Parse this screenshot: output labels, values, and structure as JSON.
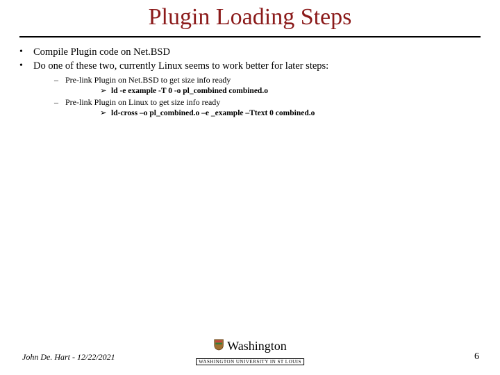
{
  "title": "Plugin Loading Steps",
  "bullets": {
    "b1": "Compile Plugin code on Net.BSD",
    "b2": "Do one of these two, currently Linux seems to work better for later steps:",
    "s1": "Pre-link Plugin on Net.BSD to get size info ready",
    "c1": "ld -e example -T 0 -o pl_combined combined.o",
    "s2": "Pre-link Plugin on Linux to get size info ready",
    "c2": "ld-cross –o pl_combined.o –e _example  –Ttext 0  combined.o"
  },
  "footer": {
    "author": "John De. Hart - 12/22/2021",
    "university": "Washington",
    "subtitle": "WASHINGTON UNIVERSITY IN ST LOUIS",
    "page": "6"
  }
}
